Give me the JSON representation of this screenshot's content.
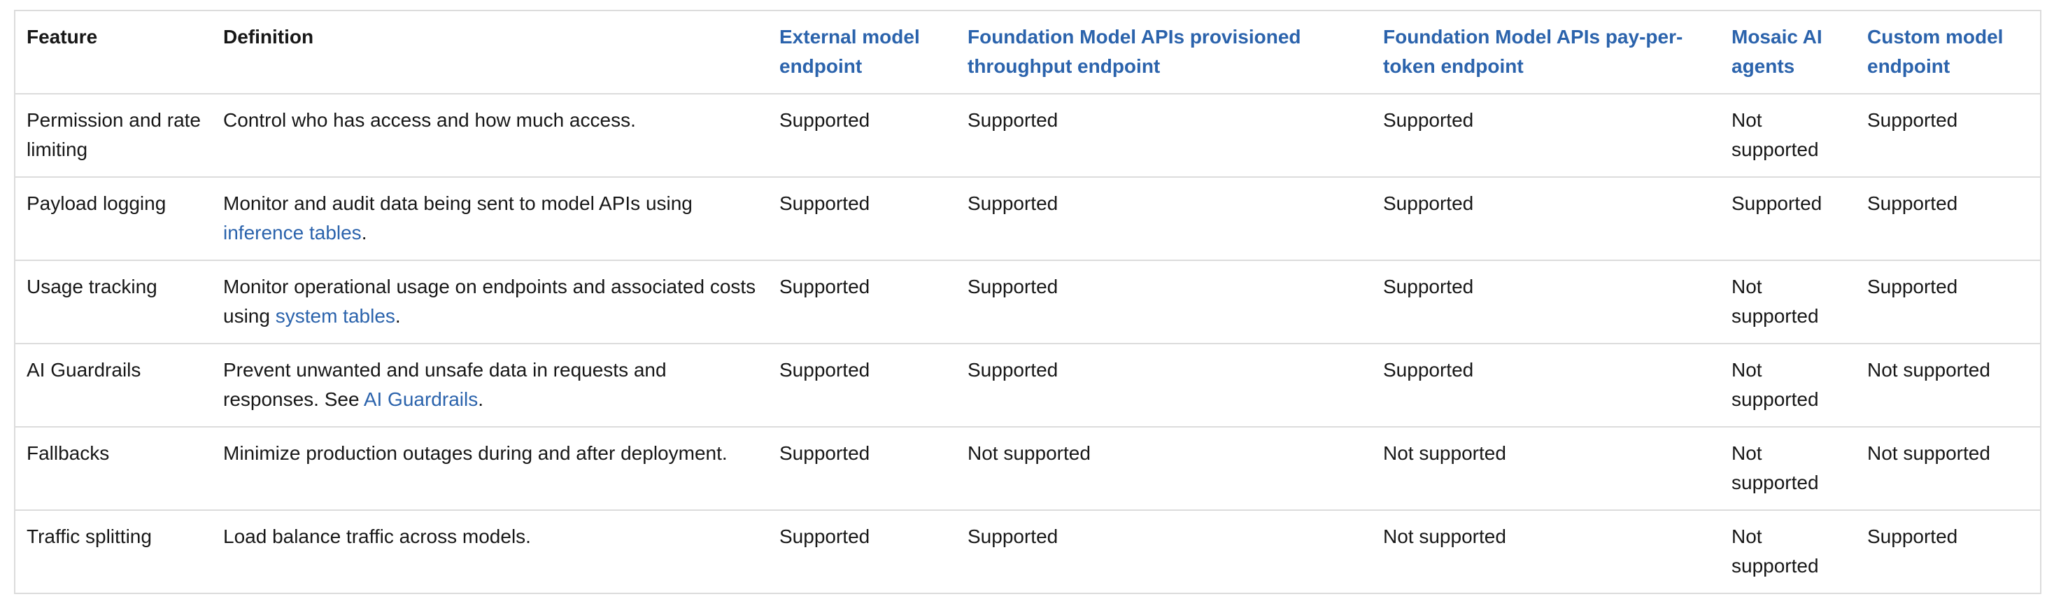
{
  "table": {
    "headers": [
      "Feature",
      "Definition",
      "External model endpoint",
      "Foundation Model APIs provisioned throughput endpoint",
      "Foundation Model APIs pay-per-token endpoint",
      "Mosaic AI agents",
      "Custom model endpoint"
    ],
    "header_links": [
      false,
      false,
      true,
      true,
      true,
      true,
      true
    ],
    "rows": [
      {
        "feature": "Permission and rate limiting",
        "definition": {
          "before": "Control who has access and how much access.",
          "link": "",
          "after": ""
        },
        "values": [
          "Supported",
          "Supported",
          "Supported",
          "Not supported",
          "Supported"
        ]
      },
      {
        "feature": "Payload logging",
        "definition": {
          "before": "Monitor and audit data being sent to model APIs using ",
          "link": "inference tables",
          "after": "."
        },
        "values": [
          "Supported",
          "Supported",
          "Supported",
          "Supported",
          "Supported"
        ]
      },
      {
        "feature": "Usage tracking",
        "definition": {
          "before": "Monitor operational usage on endpoints and associated costs using ",
          "link": "system tables",
          "after": "."
        },
        "values": [
          "Supported",
          "Supported",
          "Supported",
          "Not supported",
          "Supported"
        ]
      },
      {
        "feature": "AI Guardrails",
        "definition": {
          "before": "Prevent unwanted and unsafe data in requests and responses. See ",
          "link": "AI Guardrails",
          "after": "."
        },
        "values": [
          "Supported",
          "Supported",
          "Supported",
          "Not supported",
          "Not supported"
        ]
      },
      {
        "feature": "Fallbacks",
        "definition": {
          "before": "Minimize production outages during and after deployment.",
          "link": "",
          "after": ""
        },
        "values": [
          "Supported",
          "Not supported",
          "Not supported",
          "Not supported",
          "Not supported"
        ]
      },
      {
        "feature": "Traffic splitting",
        "definition": {
          "before": "Load balance traffic across models.",
          "link": "",
          "after": ""
        },
        "values": [
          "Supported",
          "Supported",
          "Not supported",
          "Not supported",
          "Supported"
        ]
      }
    ]
  },
  "colors": {
    "text": "#171717",
    "link": "#2b63ac",
    "border": "#dcdcdc"
  }
}
